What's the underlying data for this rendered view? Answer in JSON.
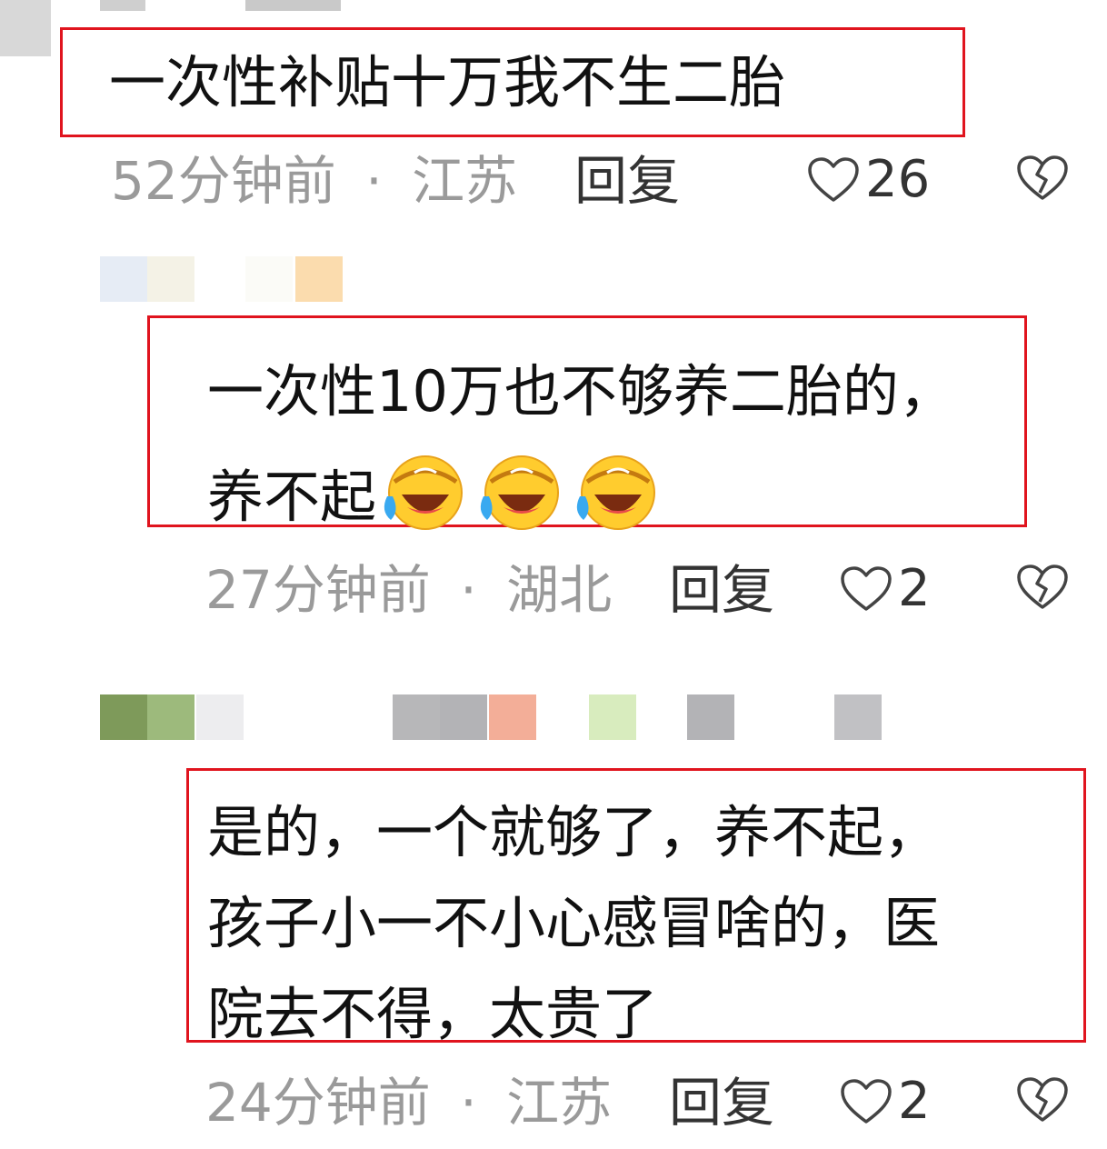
{
  "comments": [
    {
      "text_lines": [
        "一次性补贴十万我不生二胎"
      ],
      "time": "52分钟前",
      "location": "江苏",
      "reply_label": "回复",
      "like_count": "26"
    },
    {
      "text_lines": [
        "一次性10万也不够养二胎的，",
        "养不起"
      ],
      "emoji": [
        "laughing-crying-emoji",
        "laughing-crying-emoji",
        "laughing-crying-emoji"
      ],
      "time": "27分钟前",
      "location": "湖北",
      "reply_label": "回复",
      "like_count": "2"
    },
    {
      "text_lines": [
        "是的，一个就够了，养不起，",
        "孩子小一不小心感冒啥的，医",
        "院去不得，太贵了"
      ],
      "time": "24分钟前",
      "location": "江苏",
      "reply_label": "回复",
      "like_count": "2"
    }
  ],
  "separator": "·",
  "colors": {
    "highlight_border": "#e0141e",
    "meta_text": "#9a9a9a"
  }
}
